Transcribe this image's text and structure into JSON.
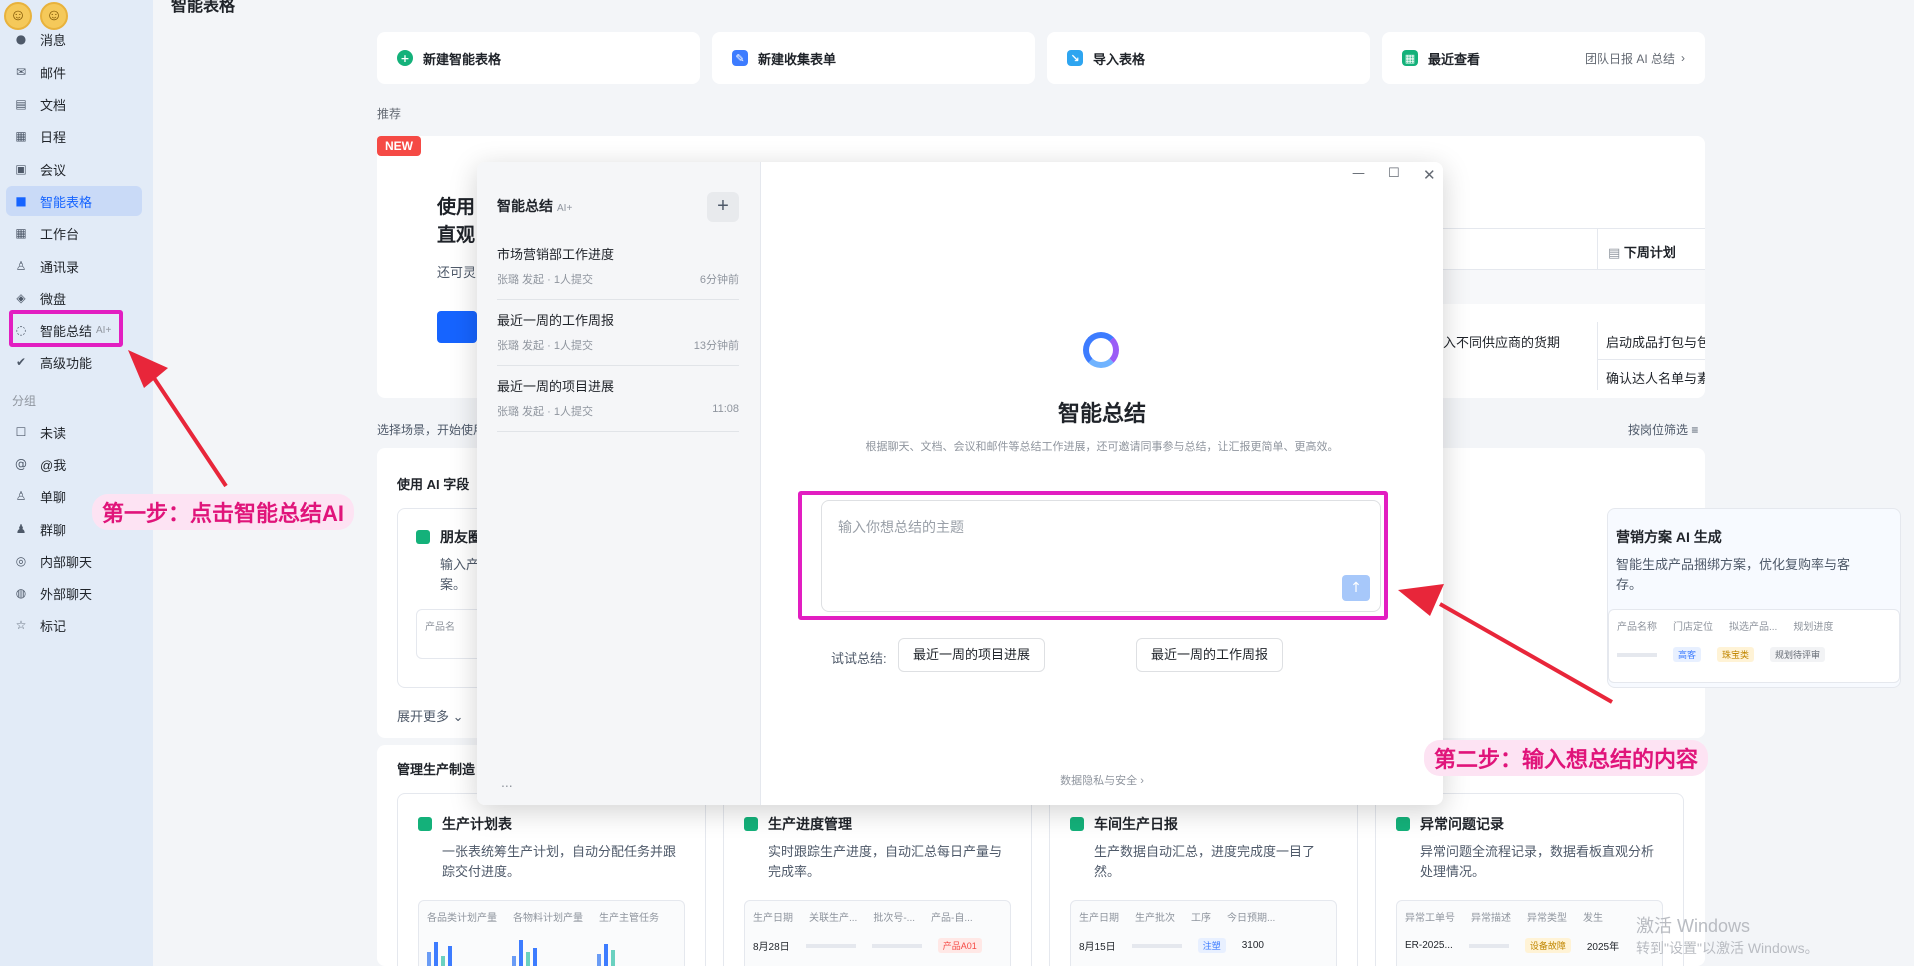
{
  "sidebar": {
    "items": [
      {
        "label": "消息",
        "icon": "chat-bubble-icon",
        "glyph": "●"
      },
      {
        "label": "邮件",
        "icon": "mail-icon",
        "glyph": "✉"
      },
      {
        "label": "文档",
        "icon": "doc-icon",
        "glyph": "▤"
      },
      {
        "label": "日程",
        "icon": "calendar-icon",
        "glyph": "▦"
      },
      {
        "label": "会议",
        "icon": "meeting-icon",
        "glyph": "▣"
      },
      {
        "label": "智能表格",
        "icon": "table-icon",
        "glyph": "■"
      },
      {
        "label": "工作台",
        "icon": "grid-icon",
        "glyph": "▦"
      },
      {
        "label": "通讯录",
        "icon": "contacts-icon",
        "glyph": "♙"
      },
      {
        "label": "微盘",
        "icon": "drive-icon",
        "glyph": "◈"
      },
      {
        "label": "智能总结",
        "icon": "ai-summary-icon",
        "glyph": "◌",
        "badge": "AI+"
      },
      {
        "label": "高级功能",
        "icon": "advanced-icon",
        "glyph": "✔"
      }
    ],
    "group_label": "分组",
    "groups": [
      {
        "label": "未读",
        "icon": "unread-icon",
        "glyph": "☐"
      },
      {
        "label": "@我",
        "icon": "at-icon",
        "glyph": "@"
      },
      {
        "label": "单聊",
        "icon": "person-icon",
        "glyph": "♙"
      },
      {
        "label": "群聊",
        "icon": "group-icon",
        "glyph": "♟"
      },
      {
        "label": "内部聊天",
        "icon": "internal-chat-icon",
        "glyph": "◎"
      },
      {
        "label": "外部聊天",
        "icon": "external-chat-icon",
        "glyph": "◍"
      },
      {
        "label": "标记",
        "icon": "star-icon",
        "glyph": "☆"
      }
    ]
  },
  "main": {
    "page_title": "智能表格",
    "actions": [
      {
        "label": "新建智能表格",
        "icon": "plus-circle-icon",
        "color": "#14b17a",
        "glyph": "+"
      },
      {
        "label": "新建收集表单",
        "icon": "form-icon",
        "color": "#3d7cff",
        "glyph": "✎"
      },
      {
        "label": "导入表格",
        "icon": "import-icon",
        "color": "#2ea5f0",
        "glyph": "↘"
      },
      {
        "label": "最近查看",
        "icon": "recent-icon",
        "color": "#14b17a",
        "glyph": "▦",
        "extra": "团队日报 AI 总结"
      }
    ],
    "recommend_label": "推荐",
    "new_badge": "NEW",
    "banner": {
      "title_line1": "使用",
      "title_line2": "直观",
      "sub": "还可灵",
      "col_header_next_week": "下周计划",
      "row1_a": "入不同供应商的货期",
      "row1_b": "启动成品打包与包",
      "row2_b": "确认达人名单与素"
    },
    "scene_text": "选择场景，开始使用",
    "filter_label": "按岗位筛选",
    "use_ai_label": "使用 AI 字段",
    "ai_card_left": {
      "title": "朋友圈",
      "desc_1": "输入产",
      "desc_2": "案。",
      "col": "产品名"
    },
    "ai_card_right": {
      "title": "营销方案 AI 生成",
      "desc_1": "智能生成产品捆绑方案，优化复购率与客",
      "desc_2": "存。",
      "cols": [
        "产品名称",
        "门店定位",
        "拟选产品...",
        "规划进度"
      ],
      "tags": [
        "高客",
        "珠宝类",
        "规划待评审"
      ]
    },
    "expand_more": "展开更多",
    "manage_label": "管理生产制造",
    "templates": [
      {
        "title": "生产计划表",
        "desc": "一张表统筹生产计划，自动分配任务并跟踪交付进度。",
        "cols": [
          "各品类计划产量",
          "各物料计划产量",
          "生产主管任务"
        ]
      },
      {
        "title": "生产进度管理",
        "desc": "实时跟踪生产进度，自动汇总每日产量与完成率。",
        "cols": [
          "生产日期",
          "关联生产...",
          "批次号-...",
          "产品-自..."
        ],
        "row": [
          "8月28日",
          "产品A01"
        ]
      },
      {
        "title": "车间生产日报",
        "desc": "生产数据自动汇总，进度完成度一目了然。",
        "cols": [
          "生产日期",
          "生产批次",
          "工序",
          "今日预期..."
        ],
        "row": [
          "8月15日",
          "注塑",
          "3100"
        ]
      },
      {
        "title": "异常问题记录",
        "desc": "异常问题全流程记录，数据看板直观分析处理情况。",
        "cols": [
          "异常工单号",
          "异常描述",
          "异常类型",
          "发生"
        ],
        "row": [
          "ER-2025...",
          "设备故障",
          "2025年"
        ]
      }
    ]
  },
  "dialog": {
    "left_title": "智能总结",
    "left_badge": "AI+",
    "history": [
      {
        "title": "市场营销部工作进度",
        "meta": "张璐 发起 · 1人提交",
        "time": "6分钟前"
      },
      {
        "title": "最近一周的工作周报",
        "meta": "张璐 发起 · 1人提交",
        "time": "13分钟前"
      },
      {
        "title": "最近一周的项目进展",
        "meta": "张璐 发起 · 1人提交",
        "time": "11:08"
      }
    ],
    "more": "...",
    "title": "智能总结",
    "subtitle": "根据聊天、文档、会议和邮件等总结工作进展，还可邀请同事参与总结，让汇报更简单、更高效。",
    "input_placeholder": "输入你想总结的主题",
    "try_label": "试试总结:",
    "suggestions": [
      "最近一周的项目进展",
      "最近一周的工作周报"
    ],
    "privacy": "数据隐私与安全 ›"
  },
  "annotations": {
    "step1": "第一步：点击智能总结AI",
    "step2": "第二步：输入想总结的内容",
    "highlight_color": "#e21ec1",
    "arrow_color": "#e8263a"
  },
  "watermark": {
    "line1": "激活 Windows",
    "line2": "转到\"设置\"以激活 Windows。"
  }
}
